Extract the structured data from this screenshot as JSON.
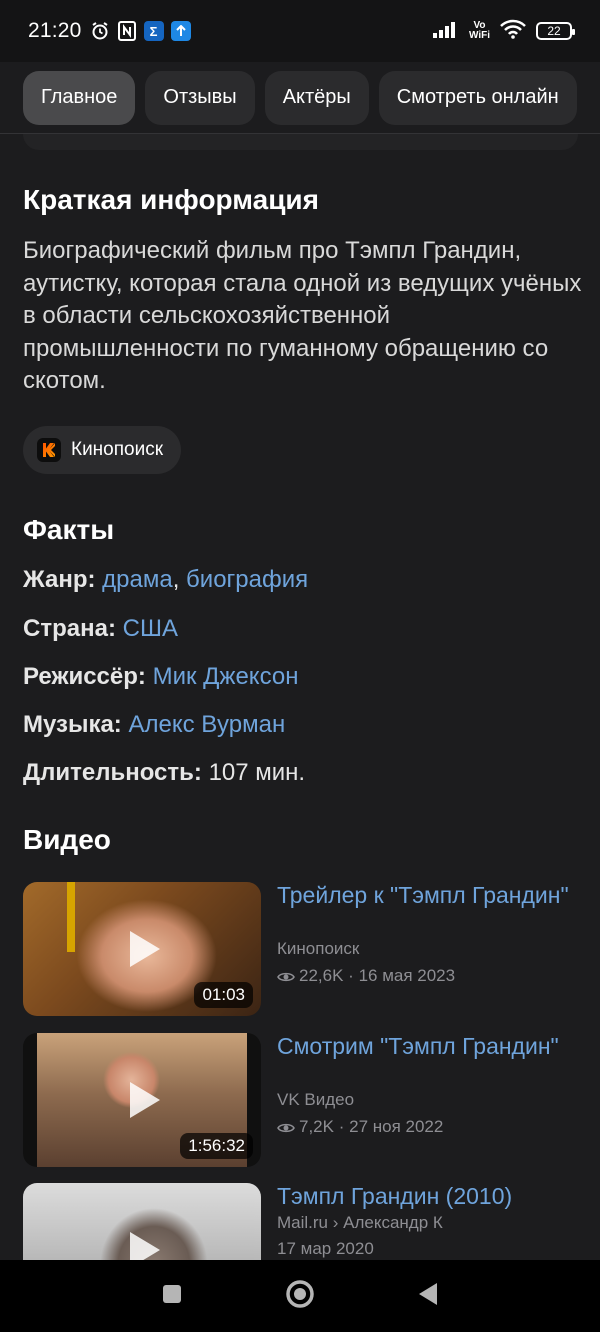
{
  "status_bar": {
    "time": "21:20",
    "notification_icons": [
      "alarm-icon",
      "nfc-icon",
      "sigma-app-icon",
      "upload-app-icon"
    ],
    "volte": "Vo\nWiFi",
    "battery": "22"
  },
  "tabs": [
    {
      "label": "Главное",
      "active": true
    },
    {
      "label": "Отзывы",
      "active": false
    },
    {
      "label": "Актёры",
      "active": false
    },
    {
      "label": "Смотреть онлайн",
      "active": false
    }
  ],
  "summary": {
    "title": "Краткая информация",
    "text": "Биографический фильм про Тэмпл Грандин, аутистку, которая стала одной из ведущих учёных в области сельскохозяйственной промышленности по гуманному обращению со скотом.",
    "source": "Кинопоиск"
  },
  "facts": {
    "title": "Факты",
    "genre_label": "Жанр:",
    "genre_1": "драма",
    "genre_sep": ",",
    "genre_2": "биография",
    "country_label": "Страна:",
    "country": "США",
    "director_label": "Режиссёр:",
    "director": "Мик Джексон",
    "music_label": "Музыка:",
    "music": "Алекс Вурман",
    "duration_label": "Длительность:",
    "duration": "107 мин."
  },
  "videos": {
    "title": "Видео",
    "items": [
      {
        "title": "Трейлер к \"Тэмпл Грандин\"",
        "source": "Кинопоиск",
        "views": "22,6K",
        "date": "16 мая 2023",
        "duration": "01:03"
      },
      {
        "title": "Смотрим \"Тэмпл Грандин\"",
        "source": "VK Видео",
        "views": "7,2K",
        "date": "27 ноя 2022",
        "duration": "1:56:32"
      },
      {
        "title": "Тэмпл Грандин (2010)",
        "source": "Mail.ru › Александр К",
        "date": "17 мар 2020"
      }
    ]
  },
  "colors": {
    "background": "#1c1c1e",
    "link": "#6fa4dc",
    "chip": "#2b2b2d",
    "active_tab": "#4a4a4c",
    "meta": "#8e8e93"
  }
}
